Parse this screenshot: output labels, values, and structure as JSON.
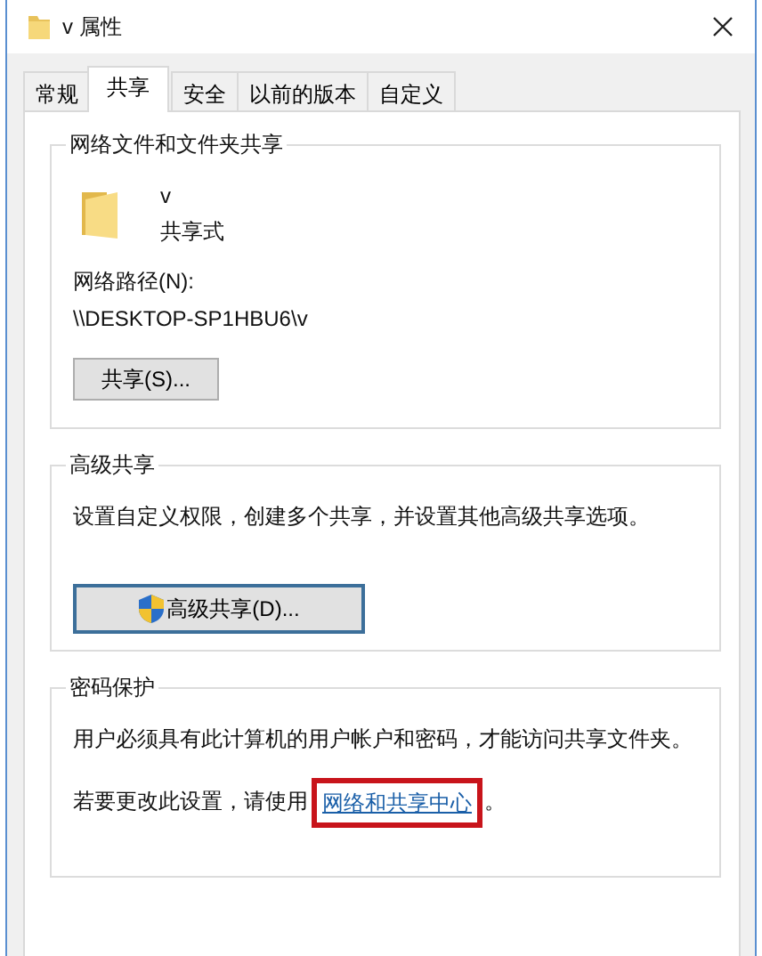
{
  "window": {
    "title": "v 属性"
  },
  "tabs": [
    {
      "label": "常规",
      "selected": false
    },
    {
      "label": "共享",
      "selected": true
    },
    {
      "label": "安全",
      "selected": false
    },
    {
      "label": "以前的版本",
      "selected": false
    },
    {
      "label": "自定义",
      "selected": false
    }
  ],
  "share_group": {
    "title": "网络文件和文件夹共享",
    "folder_name": "v",
    "status": "共享式",
    "path_label": "网络路径(N):",
    "path": "\\\\DESKTOP-SP1HBU6\\v",
    "button": "共享(S)..."
  },
  "advanced_group": {
    "title": "高级共享",
    "description": "设置自定义权限，创建多个共享，并设置其他高级共享选项。",
    "button": "高级共享(D)...",
    "button_focused": true
  },
  "password_group": {
    "title": "密码保护",
    "description": "用户必须具有此计算机的用户帐户和密码，才能访问共享文件夹。",
    "instruction": "若要更改此设置，请使用",
    "link": "网络和共享中心",
    "link_highlighted": true,
    "instruction_end": "。"
  }
}
